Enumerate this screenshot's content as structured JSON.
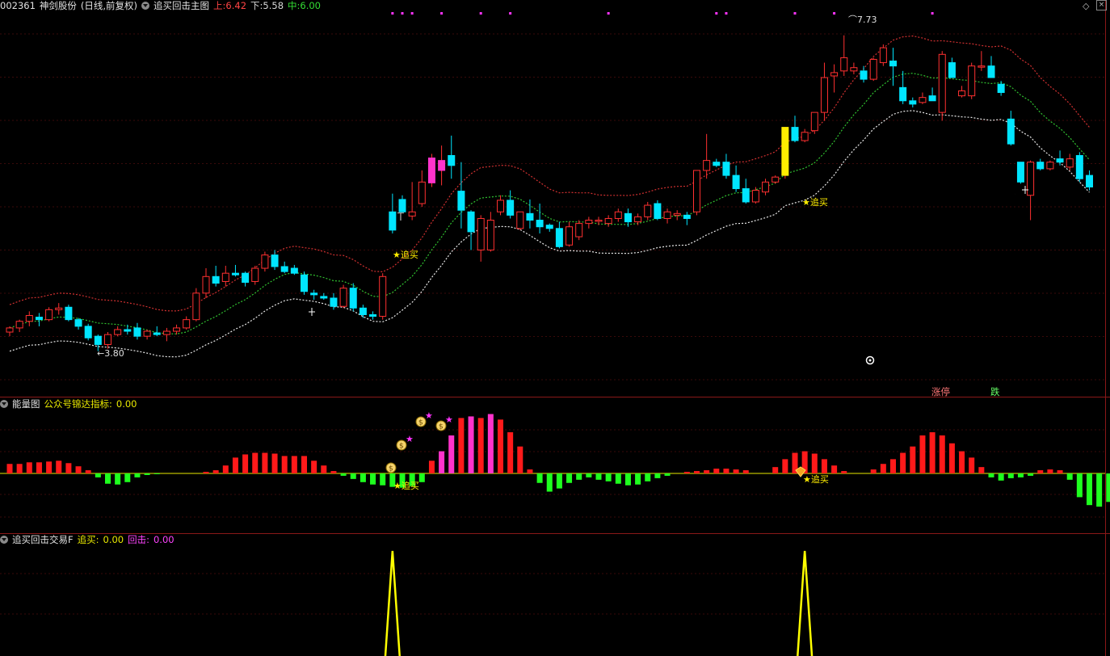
{
  "header": {
    "code": "002361",
    "name": "神剑股份",
    "period": "(日线,前复权)",
    "indicator": "追买回击主图",
    "upper_label": "上:",
    "upper_value": "6.42",
    "lower_label": "下:",
    "lower_value": "5.58",
    "mid_label": "中:",
    "mid_value": "6.00"
  },
  "energy_header": {
    "title": "能量图",
    "label": "公众号锦达指标:",
    "value": "0.00"
  },
  "trade_header": {
    "title": "追买回击交易F",
    "buy_label": "追买:",
    "buy_value": "0.00",
    "hit_label": "回击:",
    "hit_value": "0.00"
  },
  "tags": {
    "zhangting": "涨停",
    "die": "跌"
  },
  "colors": {
    "up": "#ff3030",
    "down": "#00e5ff",
    "buy_signal": "#ffee00",
    "hit_signal": "#ff33cc",
    "upper_band": "#d03030",
    "mid_band": "#30c030",
    "lower_band": "#e8e8e8",
    "energy_pos": "#ff1a1a",
    "energy_neg": "#1eff1e",
    "energy_hi": "#ff33cc",
    "trade_line": "#ffff00"
  },
  "icons": [
    "dropdown-icon",
    "money-bag-icon",
    "star-icon",
    "crosshair-icon",
    "diamond-icon",
    "close-icon"
  ],
  "chart_data": [
    {
      "type": "candlestick",
      "name_label": "追买回击主图",
      "ylim": [
        3.4,
        8.0
      ],
      "candles": [
        [
          4.15,
          4.22,
          4.1,
          4.2
        ],
        [
          4.2,
          4.3,
          4.15,
          4.28
        ],
        [
          4.28,
          4.4,
          4.22,
          4.35
        ],
        [
          4.33,
          4.38,
          4.22,
          4.3
        ],
        [
          4.3,
          4.45,
          4.28,
          4.42
        ],
        [
          4.42,
          4.5,
          4.36,
          4.44
        ],
        [
          4.45,
          4.48,
          4.28,
          4.3
        ],
        [
          4.3,
          4.32,
          4.18,
          4.22
        ],
        [
          4.22,
          4.25,
          4.05,
          4.08
        ],
        [
          4.1,
          4.12,
          3.92,
          4.0
        ],
        [
          4.0,
          4.15,
          3.95,
          4.12
        ],
        [
          4.12,
          4.22,
          4.1,
          4.18
        ],
        [
          4.18,
          4.24,
          4.12,
          4.16
        ],
        [
          4.2,
          4.26,
          4.06,
          4.1
        ],
        [
          4.1,
          4.18,
          4.06,
          4.16
        ],
        [
          4.14,
          4.22,
          4.1,
          4.12
        ],
        [
          4.12,
          4.2,
          4.04,
          4.16
        ],
        [
          4.16,
          4.24,
          4.12,
          4.2
        ],
        [
          4.2,
          4.34,
          4.18,
          4.3
        ],
        [
          4.3,
          4.68,
          4.28,
          4.62
        ],
        [
          4.62,
          4.92,
          4.56,
          4.82
        ],
        [
          4.82,
          4.95,
          4.7,
          4.74
        ],
        [
          4.76,
          4.95,
          4.7,
          4.86
        ],
        [
          4.86,
          4.96,
          4.82,
          4.84
        ],
        [
          4.86,
          4.88,
          4.7,
          4.75
        ],
        [
          4.76,
          4.95,
          4.72,
          4.92
        ],
        [
          4.92,
          5.12,
          4.88,
          5.08
        ],
        [
          5.08,
          5.14,
          4.9,
          4.94
        ],
        [
          4.94,
          5.0,
          4.86,
          4.88
        ],
        [
          4.92,
          4.96,
          4.84,
          4.86
        ],
        [
          4.84,
          4.88,
          4.6,
          4.64
        ],
        [
          4.62,
          4.66,
          4.54,
          4.6
        ],
        [
          4.58,
          4.62,
          4.54,
          4.56
        ],
        [
          4.56,
          4.62,
          4.42,
          4.46
        ],
        [
          4.46,
          4.72,
          4.44,
          4.68
        ],
        [
          4.68,
          4.74,
          4.4,
          4.44
        ],
        [
          4.44,
          4.48,
          4.32,
          4.36
        ],
        [
          4.36,
          4.4,
          4.3,
          4.34
        ],
        [
          4.34,
          4.86,
          4.3,
          4.82
        ],
        [
          5.6,
          5.82,
          5.34,
          5.38
        ],
        [
          5.75,
          5.8,
          5.6,
          5.6
        ],
        [
          5.55,
          5.96,
          5.5,
          5.6
        ],
        [
          5.7,
          6.1,
          5.66,
          5.96
        ],
        [
          5.95,
          6.3,
          5.9,
          6.25
        ],
        [
          6.1,
          6.4,
          5.92,
          6.22
        ],
        [
          6.28,
          6.52,
          6.0,
          6.16
        ],
        [
          5.85,
          6.2,
          5.4,
          5.62
        ],
        [
          5.6,
          5.62,
          5.14,
          5.36
        ],
        [
          5.14,
          5.56,
          5.0,
          5.52
        ],
        [
          5.14,
          5.6,
          5.12,
          5.5
        ],
        [
          5.6,
          5.8,
          5.56,
          5.74
        ],
        [
          5.74,
          5.86,
          5.52,
          5.56
        ],
        [
          5.4,
          5.6,
          5.38,
          5.6
        ],
        [
          5.58,
          5.75,
          5.4,
          5.5
        ],
        [
          5.5,
          5.7,
          5.34,
          5.42
        ],
        [
          5.44,
          5.46,
          5.36,
          5.4
        ],
        [
          5.4,
          5.48,
          5.16,
          5.18
        ],
        [
          5.2,
          5.48,
          5.18,
          5.42
        ],
        [
          5.3,
          5.5,
          5.26,
          5.46
        ],
        [
          5.46,
          5.54,
          5.4,
          5.5
        ],
        [
          5.5,
          5.54,
          5.44,
          5.5
        ],
        [
          5.46,
          5.56,
          5.42,
          5.52
        ],
        [
          5.52,
          5.64,
          5.48,
          5.6
        ],
        [
          5.58,
          5.64,
          5.42,
          5.48
        ],
        [
          5.48,
          5.58,
          5.44,
          5.54
        ],
        [
          5.54,
          5.72,
          5.5,
          5.68
        ],
        [
          5.7,
          5.74,
          5.5,
          5.52
        ],
        [
          5.52,
          5.64,
          5.46,
          5.6
        ],
        [
          5.56,
          5.62,
          5.5,
          5.58
        ],
        [
          5.56,
          5.6,
          5.44,
          5.52
        ],
        [
          5.6,
          6.1,
          5.56,
          6.1
        ],
        [
          6.1,
          6.54,
          6.0,
          6.22
        ],
        [
          6.2,
          6.24,
          6.14,
          6.16
        ],
        [
          6.2,
          6.3,
          6.0,
          6.04
        ],
        [
          6.04,
          6.16,
          5.84,
          5.88
        ],
        [
          5.88,
          6.0,
          5.7,
          5.72
        ],
        [
          5.72,
          5.9,
          5.7,
          5.86
        ],
        [
          5.84,
          6.0,
          5.8,
          5.96
        ],
        [
          5.96,
          6.04,
          5.94,
          6.02
        ],
        [
          6.04,
          6.62,
          6.0,
          6.62
        ],
        [
          6.62,
          6.76,
          6.44,
          6.46
        ],
        [
          6.46,
          6.6,
          6.44,
          6.56
        ],
        [
          6.58,
          6.8,
          6.54,
          6.8
        ],
        [
          6.8,
          7.4,
          6.7,
          7.22
        ],
        [
          7.24,
          7.38,
          7.04,
          7.28
        ],
        [
          7.3,
          7.73,
          7.24,
          7.46
        ],
        [
          7.3,
          7.4,
          7.26,
          7.34
        ],
        [
          7.3,
          7.36,
          7.16,
          7.2
        ],
        [
          7.2,
          7.46,
          7.18,
          7.44
        ],
        [
          7.4,
          7.62,
          7.36,
          7.58
        ],
        [
          7.42,
          7.58,
          7.12,
          7.36
        ],
        [
          7.1,
          7.3,
          6.9,
          6.94
        ],
        [
          6.94,
          6.98,
          6.86,
          6.9
        ],
        [
          6.92,
          7.04,
          6.9,
          6.98
        ],
        [
          7.0,
          7.1,
          6.94,
          6.94
        ],
        [
          6.8,
          7.54,
          6.7,
          7.5
        ],
        [
          7.4,
          7.46,
          7.22,
          7.22
        ],
        [
          7.0,
          7.12,
          6.98,
          7.06
        ],
        [
          7.0,
          7.4,
          6.96,
          7.36
        ],
        [
          7.36,
          7.54,
          7.3,
          7.36
        ],
        [
          7.36,
          7.48,
          7.22,
          7.22
        ],
        [
          7.14,
          7.18,
          7.0,
          7.04
        ],
        [
          6.72,
          6.82,
          6.4,
          6.42
        ],
        [
          6.2,
          6.2,
          5.94,
          5.96
        ],
        [
          5.8,
          6.22,
          5.5,
          6.2
        ],
        [
          6.2,
          6.24,
          6.1,
          6.12
        ],
        [
          6.12,
          6.22,
          6.1,
          6.2
        ],
        [
          6.24,
          6.34,
          6.16,
          6.2
        ],
        [
          6.14,
          6.3,
          6.1,
          6.24
        ],
        [
          6.28,
          6.32,
          5.96,
          6.0
        ],
        [
          6.04,
          6.1,
          5.86,
          5.9
        ]
      ],
      "annotations": [
        {
          "text": "3.80",
          "kind": "low"
        },
        {
          "text": "7.73",
          "kind": "high"
        },
        {
          "text": "★追买",
          "kind": "signal"
        },
        {
          "text": "★追买",
          "kind": "signal"
        },
        {
          "text": "★追买",
          "kind": "signal"
        }
      ]
    },
    {
      "type": "bar",
      "name_label": "能量图",
      "values": [
        12,
        12,
        14,
        14,
        15,
        16,
        13,
        9,
        4,
        -5,
        -13,
        -14,
        -11,
        -5,
        -2,
        -1,
        0,
        0,
        0,
        0,
        2,
        4,
        10,
        20,
        24,
        26,
        26,
        25,
        22,
        22,
        22,
        16,
        10,
        3,
        -3,
        -7,
        -11,
        -14,
        -15,
        -17,
        -18,
        -16,
        -11,
        16,
        28,
        48,
        70,
        72,
        70,
        75,
        68,
        52,
        34,
        5,
        -12,
        -23,
        -19,
        -12,
        -8,
        -5,
        -8,
        -10,
        -13,
        -15,
        -14,
        -10,
        -6,
        -3,
        0,
        2,
        3,
        4,
        6,
        6,
        5,
        4,
        0,
        0,
        8,
        18,
        26,
        28,
        25,
        18,
        10,
        3,
        0,
        0,
        5,
        12,
        18,
        26,
        34,
        48,
        52,
        48,
        38,
        28,
        20,
        8,
        -5,
        -9,
        -6,
        -5,
        -3,
        4,
        5,
        4,
        -8,
        -30,
        -40,
        -42,
        -36,
        -26,
        -19,
        -16,
        -15
      ],
      "highlight_indices": [
        44,
        45,
        47,
        49
      ],
      "annotations": [
        {
          "text": "★追买"
        },
        {
          "text": "★追买"
        }
      ]
    },
    {
      "type": "line",
      "name_label": "追买回击交易F",
      "series": [
        {
          "name": "追买",
          "values": [
            0,
            1,
            0,
            1,
            0
          ]
        }
      ]
    }
  ]
}
